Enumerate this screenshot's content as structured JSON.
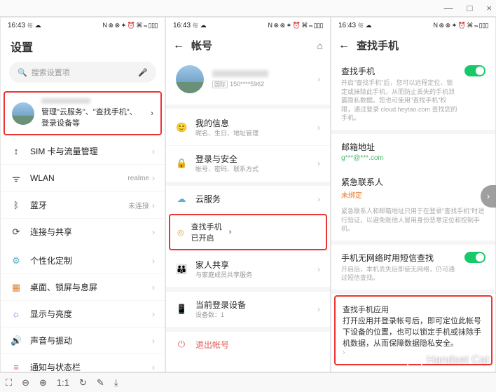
{
  "window": {
    "min": "—",
    "max": "□",
    "close": "×"
  },
  "status": {
    "time": "16:43",
    "time_suffix": "每",
    "icons": "N ⊗ ⊗ ✶ ⏰ ⌘ ⫬ ▯▯▯"
  },
  "watermark": "Handset Cat",
  "panel1": {
    "title": "设置",
    "search_placeholder": "搜索设置项",
    "account_sub": "管理\"云服务\"、\"查找手机\"、登录设备等",
    "items": [
      {
        "icon": "↕",
        "title": "SIM 卡与流量管理"
      },
      {
        "icon": "ᯤ",
        "title": "WLAN",
        "right": "realme"
      },
      {
        "icon": "ᛒ",
        "title": "蓝牙",
        "right": "未连接"
      },
      {
        "icon": "⟳",
        "title": "连接与共享"
      }
    ],
    "items2": [
      {
        "icon": "⚙",
        "title": "个性化定制",
        "color": "#5ab0c9"
      },
      {
        "icon": "▦",
        "title": "桌面、锁屏与息屏",
        "color": "#e08030"
      },
      {
        "icon": "☼",
        "title": "显示与亮度",
        "color": "#5a7fe0"
      },
      {
        "icon": "🔊",
        "title": "声音与振动",
        "color": "#5fc07a"
      },
      {
        "icon": "≡",
        "title": "通知与状态栏",
        "color": "#e06060"
      }
    ]
  },
  "panel2": {
    "header": "帐号",
    "phone": "150****5962",
    "items": [
      {
        "icon": "🙂",
        "title": "我的信息",
        "sub": "昵名、生日、地址管理"
      },
      {
        "icon": "🔒",
        "title": "登录与安全",
        "sub": "帐号、密码、联系方式"
      }
    ],
    "cloud": {
      "icon": "☁",
      "title": "云服务"
    },
    "find": {
      "icon": "◎",
      "title": "查找手机",
      "tag": "已开启"
    },
    "family": {
      "icon": "👪",
      "title": "家人共享",
      "sub": "与家庭成员共享服务"
    },
    "device": {
      "icon": "📱",
      "title": "当前登录设备",
      "sub": "设备数：1"
    },
    "logout": {
      "icon": "⏻",
      "title": "退出帐号"
    }
  },
  "panel3": {
    "header": "查找手机",
    "main": {
      "title": "查找手机",
      "sub": "开启\"查找手机\"后，您可以远程定位、锁定或抹除此手机，从而防止丢失的手机泄露隐私数据。您也可使用\"查找手机\"权限，通过登录 cloud.heytao.com 查找您的手机。"
    },
    "email": {
      "title": "邮箱地址",
      "value": "g***@***.com"
    },
    "contact": {
      "title": "紧急联系人",
      "status": "未绑定"
    },
    "contact_note": "紧急联系人和邮箱地址只用于在登录\"查找手机\"时进行验证，以避免账他人冒用身份恶意定位和控制手机。",
    "sms": {
      "title": "手机无网络时用短信查找",
      "sub": "开启后，本机丢失后即使无网络，仍可通过短信查找。"
    },
    "app": {
      "title": "查找手机应用",
      "sub": "打开应用并登录帐号后，即可定位此帐号下设备的位置，也可以锁定手机或抹除手机数据，从而保障数据隐私安全。"
    }
  },
  "bottom": {
    "fit": "⛶",
    "zoom_out": "⊖",
    "zoom_in": "⊕",
    "one": "1:1",
    "rotate": "↻",
    "edit": "✎",
    "download": "⤓"
  }
}
